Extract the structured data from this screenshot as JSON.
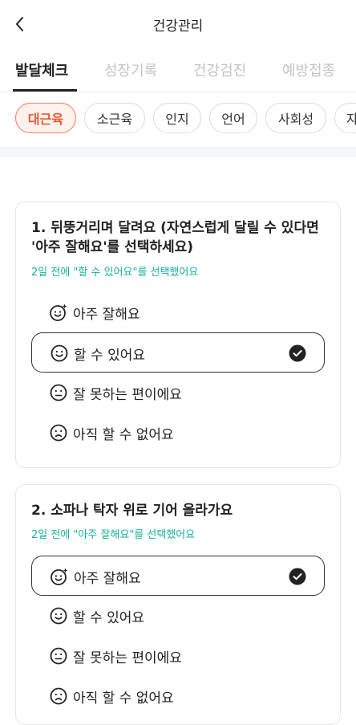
{
  "header": {
    "title": "건강관리",
    "back_icon": "chevron-left-icon"
  },
  "tabs": [
    {
      "label": "발달체크",
      "active": true
    },
    {
      "label": "성장기록",
      "active": false
    },
    {
      "label": "건강검진",
      "active": false
    },
    {
      "label": "예방접종",
      "active": false
    }
  ],
  "chips": [
    {
      "label": "대근육",
      "active": true
    },
    {
      "label": "소근육",
      "active": false
    },
    {
      "label": "인지",
      "active": false
    },
    {
      "label": "언어",
      "active": false
    },
    {
      "label": "사회성",
      "active": false
    },
    {
      "label": "자",
      "active": false
    }
  ],
  "questions": [
    {
      "title": "1. 뒤뚱거리며 달려요 (자연스럽게 달릴 수 있다면 '아주 잘해요'를 선택하세요)",
      "status": "2일 전에 \"할 수 있어요\"를 선택했어요",
      "options": [
        {
          "label": "아주 잘해요",
          "icon": "smile-sparkle-icon",
          "selected": false
        },
        {
          "label": "할 수 있어요",
          "icon": "smile-icon",
          "selected": true
        },
        {
          "label": "잘 못하는 편이에요",
          "icon": "neutral-face-icon",
          "selected": false
        },
        {
          "label": "아직 할 수 없어요",
          "icon": "sad-face-icon",
          "selected": false
        }
      ]
    },
    {
      "title": "2. 소파나 탁자 위로 기어 올라가요",
      "status": "2일 전에 \"아주 잘해요\"를 선택했어요",
      "options": [
        {
          "label": "아주 잘해요",
          "icon": "smile-sparkle-icon",
          "selected": true
        },
        {
          "label": "할 수 있어요",
          "icon": "smile-icon",
          "selected": false
        },
        {
          "label": "잘 못하는 편이에요",
          "icon": "neutral-face-icon",
          "selected": false
        },
        {
          "label": "아직 할 수 없어요",
          "icon": "sad-face-icon",
          "selected": false
        }
      ]
    }
  ],
  "colors": {
    "accent": "#f27b5b",
    "accent_bg": "#fff2ed",
    "status_text": "#17b297",
    "inactive_tab": "#c4c4c4"
  }
}
